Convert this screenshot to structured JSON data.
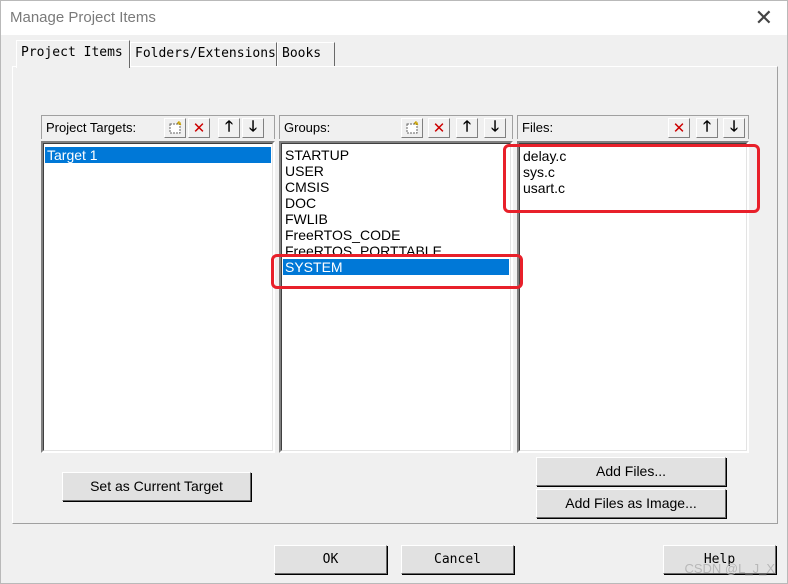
{
  "window": {
    "title": "Manage Project Items",
    "close_label": "✕"
  },
  "tabs": [
    {
      "label": "Project Items"
    },
    {
      "label": "Folders/Extensions"
    },
    {
      "label": "Books"
    }
  ],
  "targets": {
    "label": "Project Targets:",
    "items": [
      "Target 1"
    ],
    "selected": "Target 1"
  },
  "groups": {
    "label": "Groups:",
    "items": [
      "STARTUP",
      "USER",
      "CMSIS",
      "DOC",
      "FWLIB",
      "FreeRTOS_CODE",
      "FreeRTOS_PORTTABLE",
      "SYSTEM"
    ],
    "selected": "SYSTEM"
  },
  "files": {
    "label": "Files:",
    "items": [
      "delay.c",
      "sys.c",
      "usart.c"
    ]
  },
  "buttons": {
    "set_current": "Set as Current Target",
    "add_files": "Add Files...",
    "add_files_image": "Add Files as Image...",
    "ok": "OK",
    "cancel": "Cancel",
    "help": "Help"
  },
  "watermark": "CSDN @L_J_X",
  "colors": {
    "selection": "#0078d7",
    "highlight_box": "#e8202a",
    "delete_icon": "#cc0000"
  }
}
